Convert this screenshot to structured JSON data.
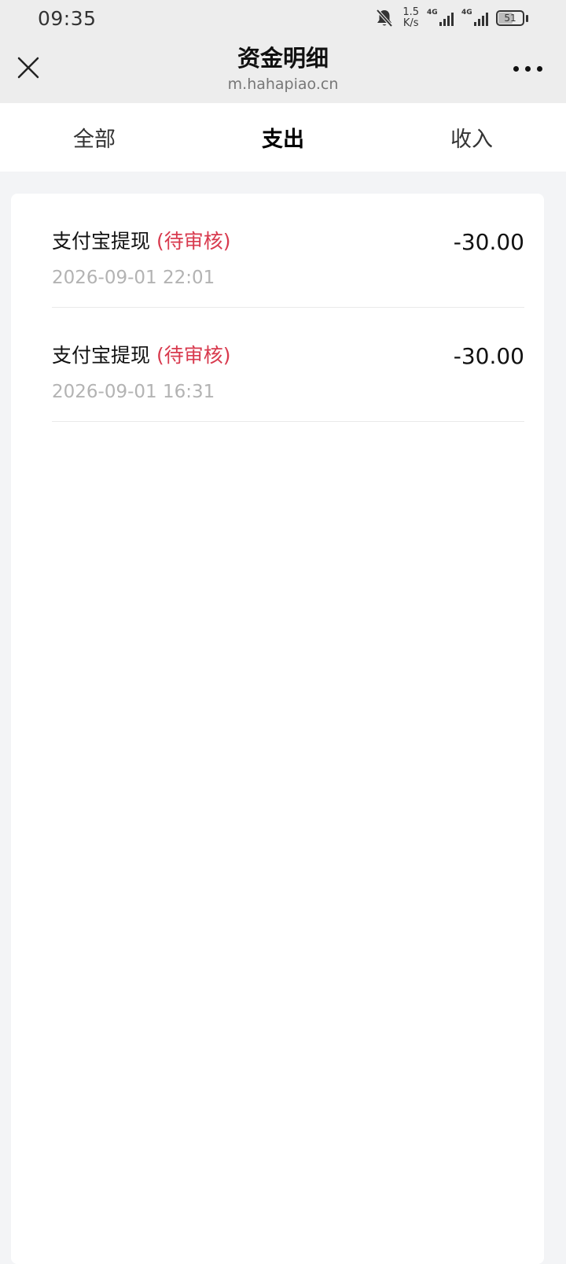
{
  "status_bar": {
    "time": "09:35",
    "net_speed_value": "1.5",
    "net_speed_unit": "K/s",
    "signal1_tag": "4G",
    "signal2_tag": "4G",
    "battery": "51"
  },
  "header": {
    "title": "资金明细",
    "url": "m.hahapiao.cn"
  },
  "tabs": [
    {
      "label": "全部",
      "active": false
    },
    {
      "label": "支出",
      "active": true
    },
    {
      "label": "收入",
      "active": false
    }
  ],
  "records": [
    {
      "title": "支付宝提现",
      "status": "(待审核)",
      "time": "2026-09-01 22:01",
      "amount": "-30.00"
    },
    {
      "title": "支付宝提现",
      "status": "(待审核)",
      "time": "2026-09-01 16:31",
      "amount": "-30.00"
    }
  ],
  "colors": {
    "status_pending": "#d83a4e",
    "header_bg": "#ededed",
    "page_bg": "#f3f4f6"
  }
}
